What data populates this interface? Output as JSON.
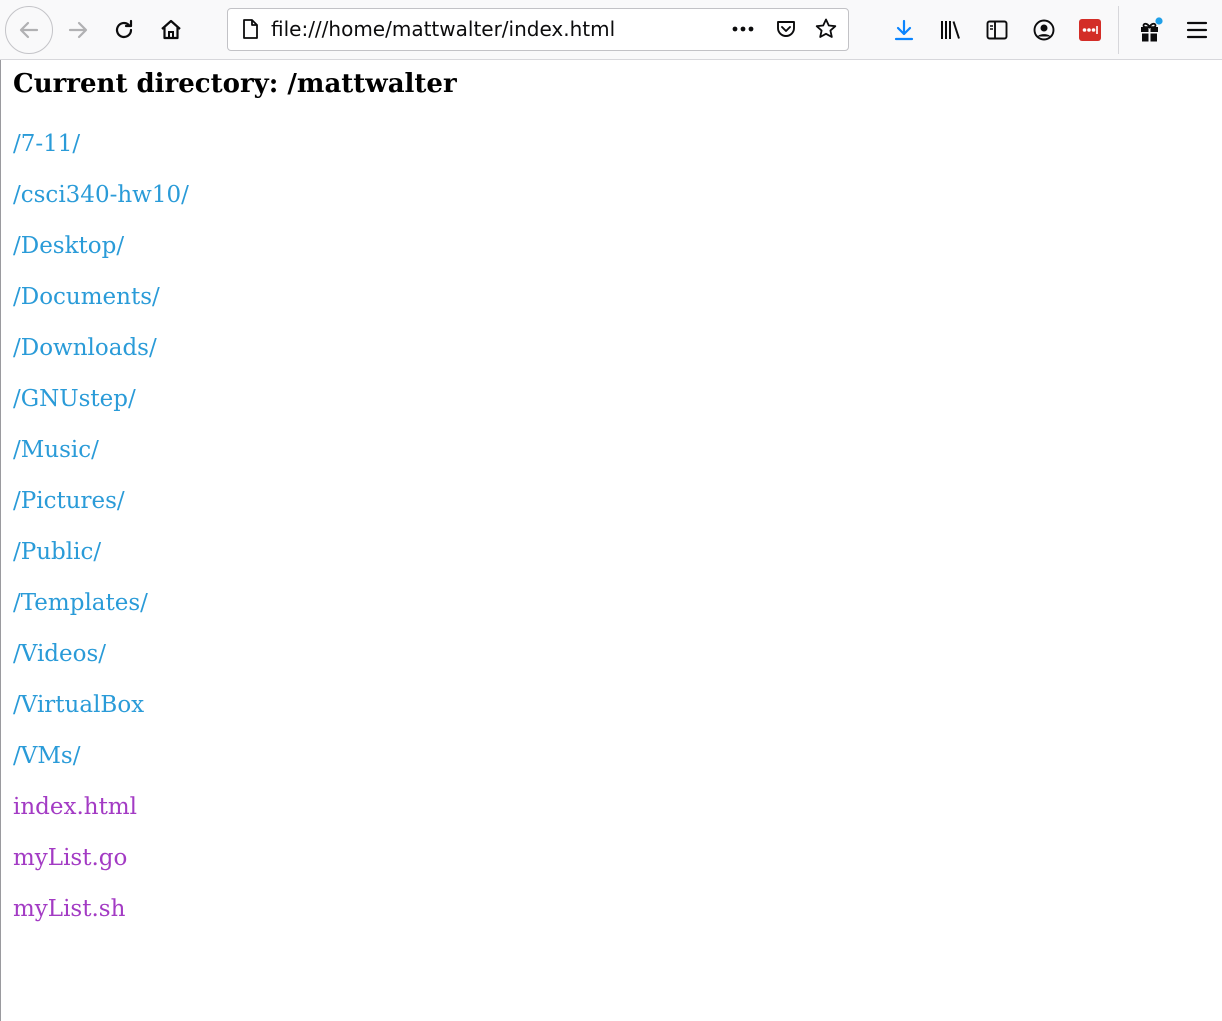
{
  "browser": {
    "url": "file:///home/mattwalter/index.html",
    "link_color": "#2a9bd8",
    "visited_color": "#a33bc4",
    "icons": {
      "back": "back-arrow-icon",
      "forward": "forward-arrow-icon",
      "reload": "reload-icon",
      "home": "home-icon",
      "page": "page-icon",
      "more": "more-dots-icon",
      "pocket": "pocket-icon",
      "bookmark": "star-icon",
      "downloads": "download-icon",
      "library": "library-icon",
      "sidebar": "sidebar-icon",
      "account": "account-icon",
      "extension": "lastpass-icon",
      "whatsnew": "gift-icon",
      "menu": "hamburger-menu-icon"
    }
  },
  "page": {
    "heading": "Current directory: /mattwalter",
    "entries": [
      {
        "label": "/7-11/",
        "visited": false
      },
      {
        "label": "/csci340-hw10/",
        "visited": false
      },
      {
        "label": "/Desktop/",
        "visited": false
      },
      {
        "label": "/Documents/",
        "visited": false
      },
      {
        "label": "/Downloads/",
        "visited": false
      },
      {
        "label": "/GNUstep/",
        "visited": false
      },
      {
        "label": "/Music/",
        "visited": false
      },
      {
        "label": "/Pictures/",
        "visited": false
      },
      {
        "label": "/Public/",
        "visited": false
      },
      {
        "label": "/Templates/",
        "visited": false
      },
      {
        "label": "/Videos/",
        "visited": false
      },
      {
        "label": "/VirtualBox",
        "visited": false
      },
      {
        "label": "/VMs/",
        "visited": false
      },
      {
        "label": "index.html",
        "visited": true
      },
      {
        "label": "myList.go",
        "visited": true
      },
      {
        "label": "myList.sh",
        "visited": true
      }
    ]
  }
}
